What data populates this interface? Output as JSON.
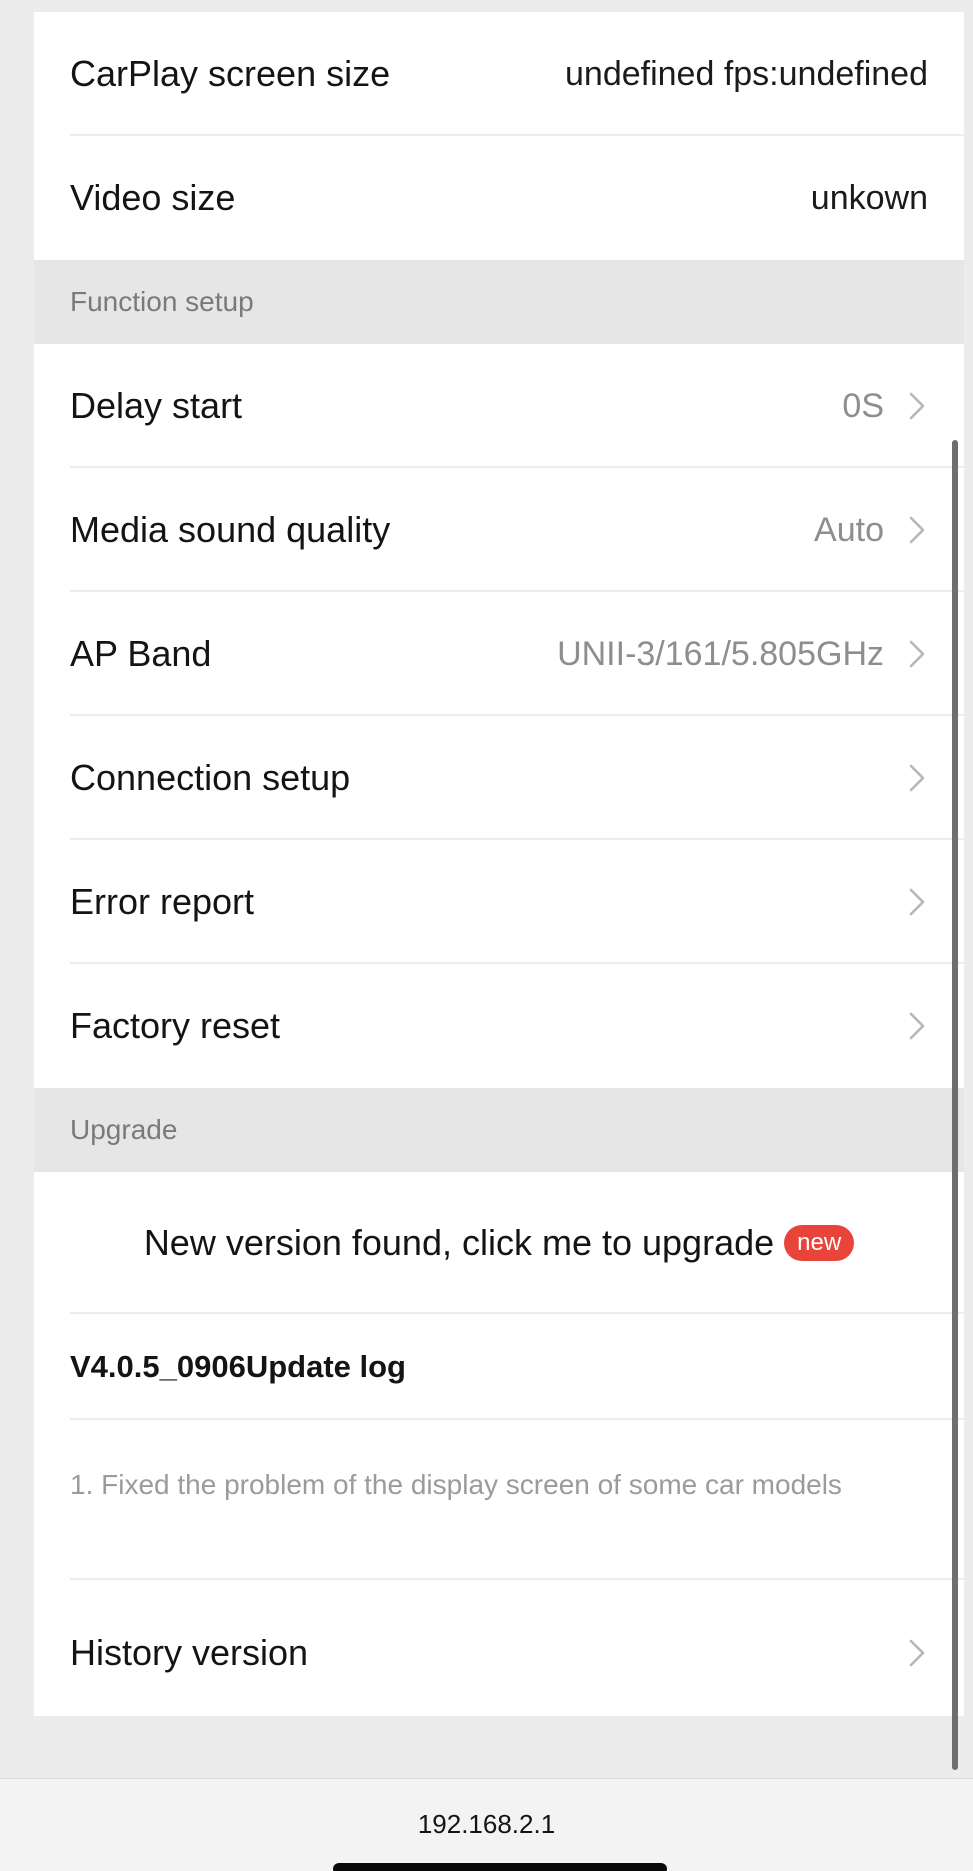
{
  "info": {
    "carplay_label": "CarPlay screen size",
    "carplay_value": "undefined fps:undefined",
    "video_label": "Video size",
    "video_value": "unkown"
  },
  "function_setup": {
    "header": "Function setup",
    "items": [
      {
        "label": "Delay start",
        "value": "0S"
      },
      {
        "label": "Media sound quality",
        "value": "Auto"
      },
      {
        "label": "AP Band",
        "value": "UNII-3/161/5.805GHz"
      },
      {
        "label": "Connection setup",
        "value": ""
      },
      {
        "label": "Error report",
        "value": ""
      },
      {
        "label": "Factory reset",
        "value": ""
      }
    ]
  },
  "upgrade": {
    "header": "Upgrade",
    "prompt": "New version found, click me to upgrade",
    "badge": "new",
    "log_title": "V4.0.5_0906Update log",
    "log_body": "1. Fixed the problem of the display screen of some car models",
    "history_label": "History version"
  },
  "browser": {
    "address": "192.168.2.1"
  },
  "icons": {
    "chevron": "chevron-right-icon"
  },
  "colors": {
    "badge": "#e8443a",
    "section_bg": "#e6e6e6"
  }
}
